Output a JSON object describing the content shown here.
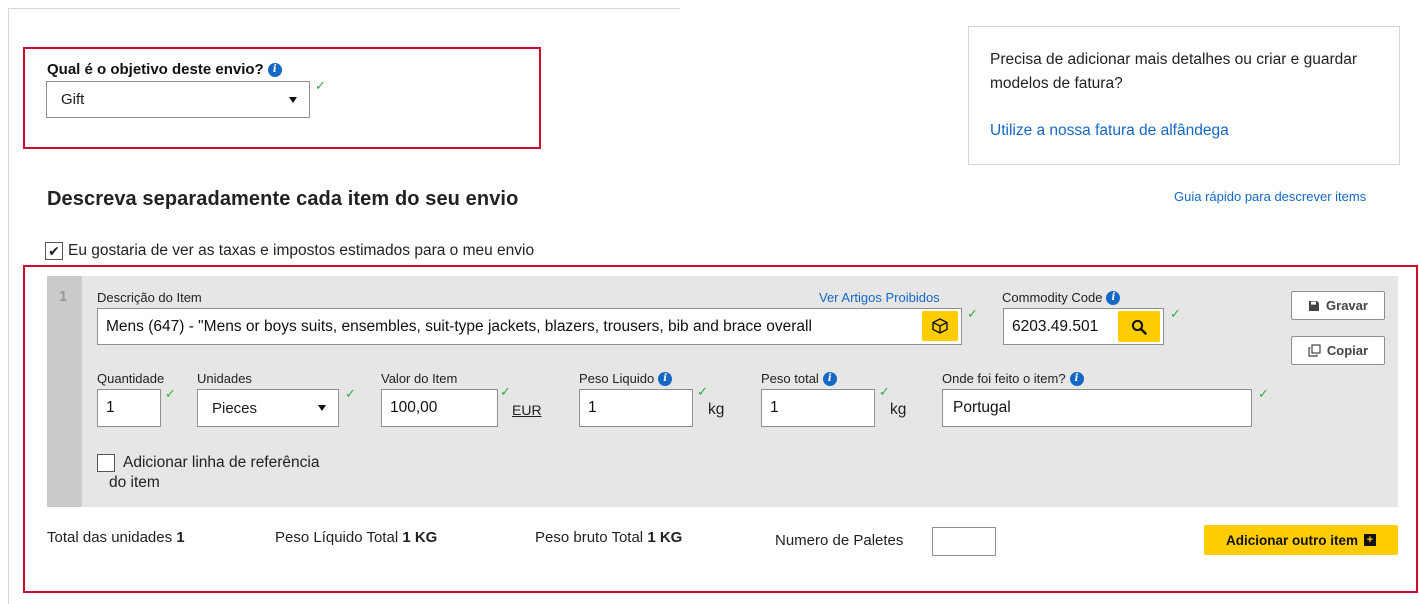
{
  "purpose": {
    "label": "Qual é o objetivo deste envio?",
    "selected": "Gift"
  },
  "help": {
    "text": "Precisa de adicionar mais detalhes ou criar e guardar modelos de fatura?",
    "link": "Utilize a nossa fatura de alfândega"
  },
  "section": {
    "title": "Descreva separadamente cada item do seu envio",
    "quick_guide": "Guia rápido para descrever items"
  },
  "taxes": {
    "checked": true,
    "label": "Eu gostaria de ver as taxas e impostos estimados para o meu envio"
  },
  "item": {
    "number": "1",
    "description_label": "Descrição do Item",
    "prohibited_link": "Ver Artigos Proibidos",
    "description_value": "Mens (647) - \"Mens or boys suits, ensembles, suit-type jackets, blazers, trousers, bib and brace overall",
    "commodity_label": "Commodity Code",
    "commodity_value": "6203.49.501",
    "save_label": "Gravar",
    "copy_label": "Copiar",
    "quantity_label": "Quantidade",
    "quantity_value": "1",
    "units_label": "Unidades",
    "units_value": "Pieces",
    "value_label": "Valor do Item",
    "value_value": "100,00",
    "currency": "EUR",
    "net_weight_label": "Peso Liquido",
    "net_weight_value": "1",
    "total_weight_label": "Peso total",
    "total_weight_value": "1",
    "weight_unit": "kg",
    "origin_label": "Onde foi feito o item?",
    "origin_value": "Portugal",
    "reference_label_1": "Adicionar linha de referência",
    "reference_label_2": "do item"
  },
  "footer": {
    "total_units_label": "Total das unidades",
    "total_units_value": "1",
    "net_total_label": "Peso Líquido Total",
    "net_total_value": "1 KG",
    "gross_total_label": "Peso bruto Total",
    "gross_total_value": "1 KG",
    "pallets_label": "Numero de Paletes",
    "pallets_value": "",
    "add_item_label": "Adicionar outro item"
  },
  "colors": {
    "accent_blue": "#1568c5",
    "dhl_yellow": "#ffcc00",
    "highlight_red": "#c8102e",
    "valid_green": "#2eae3a"
  }
}
